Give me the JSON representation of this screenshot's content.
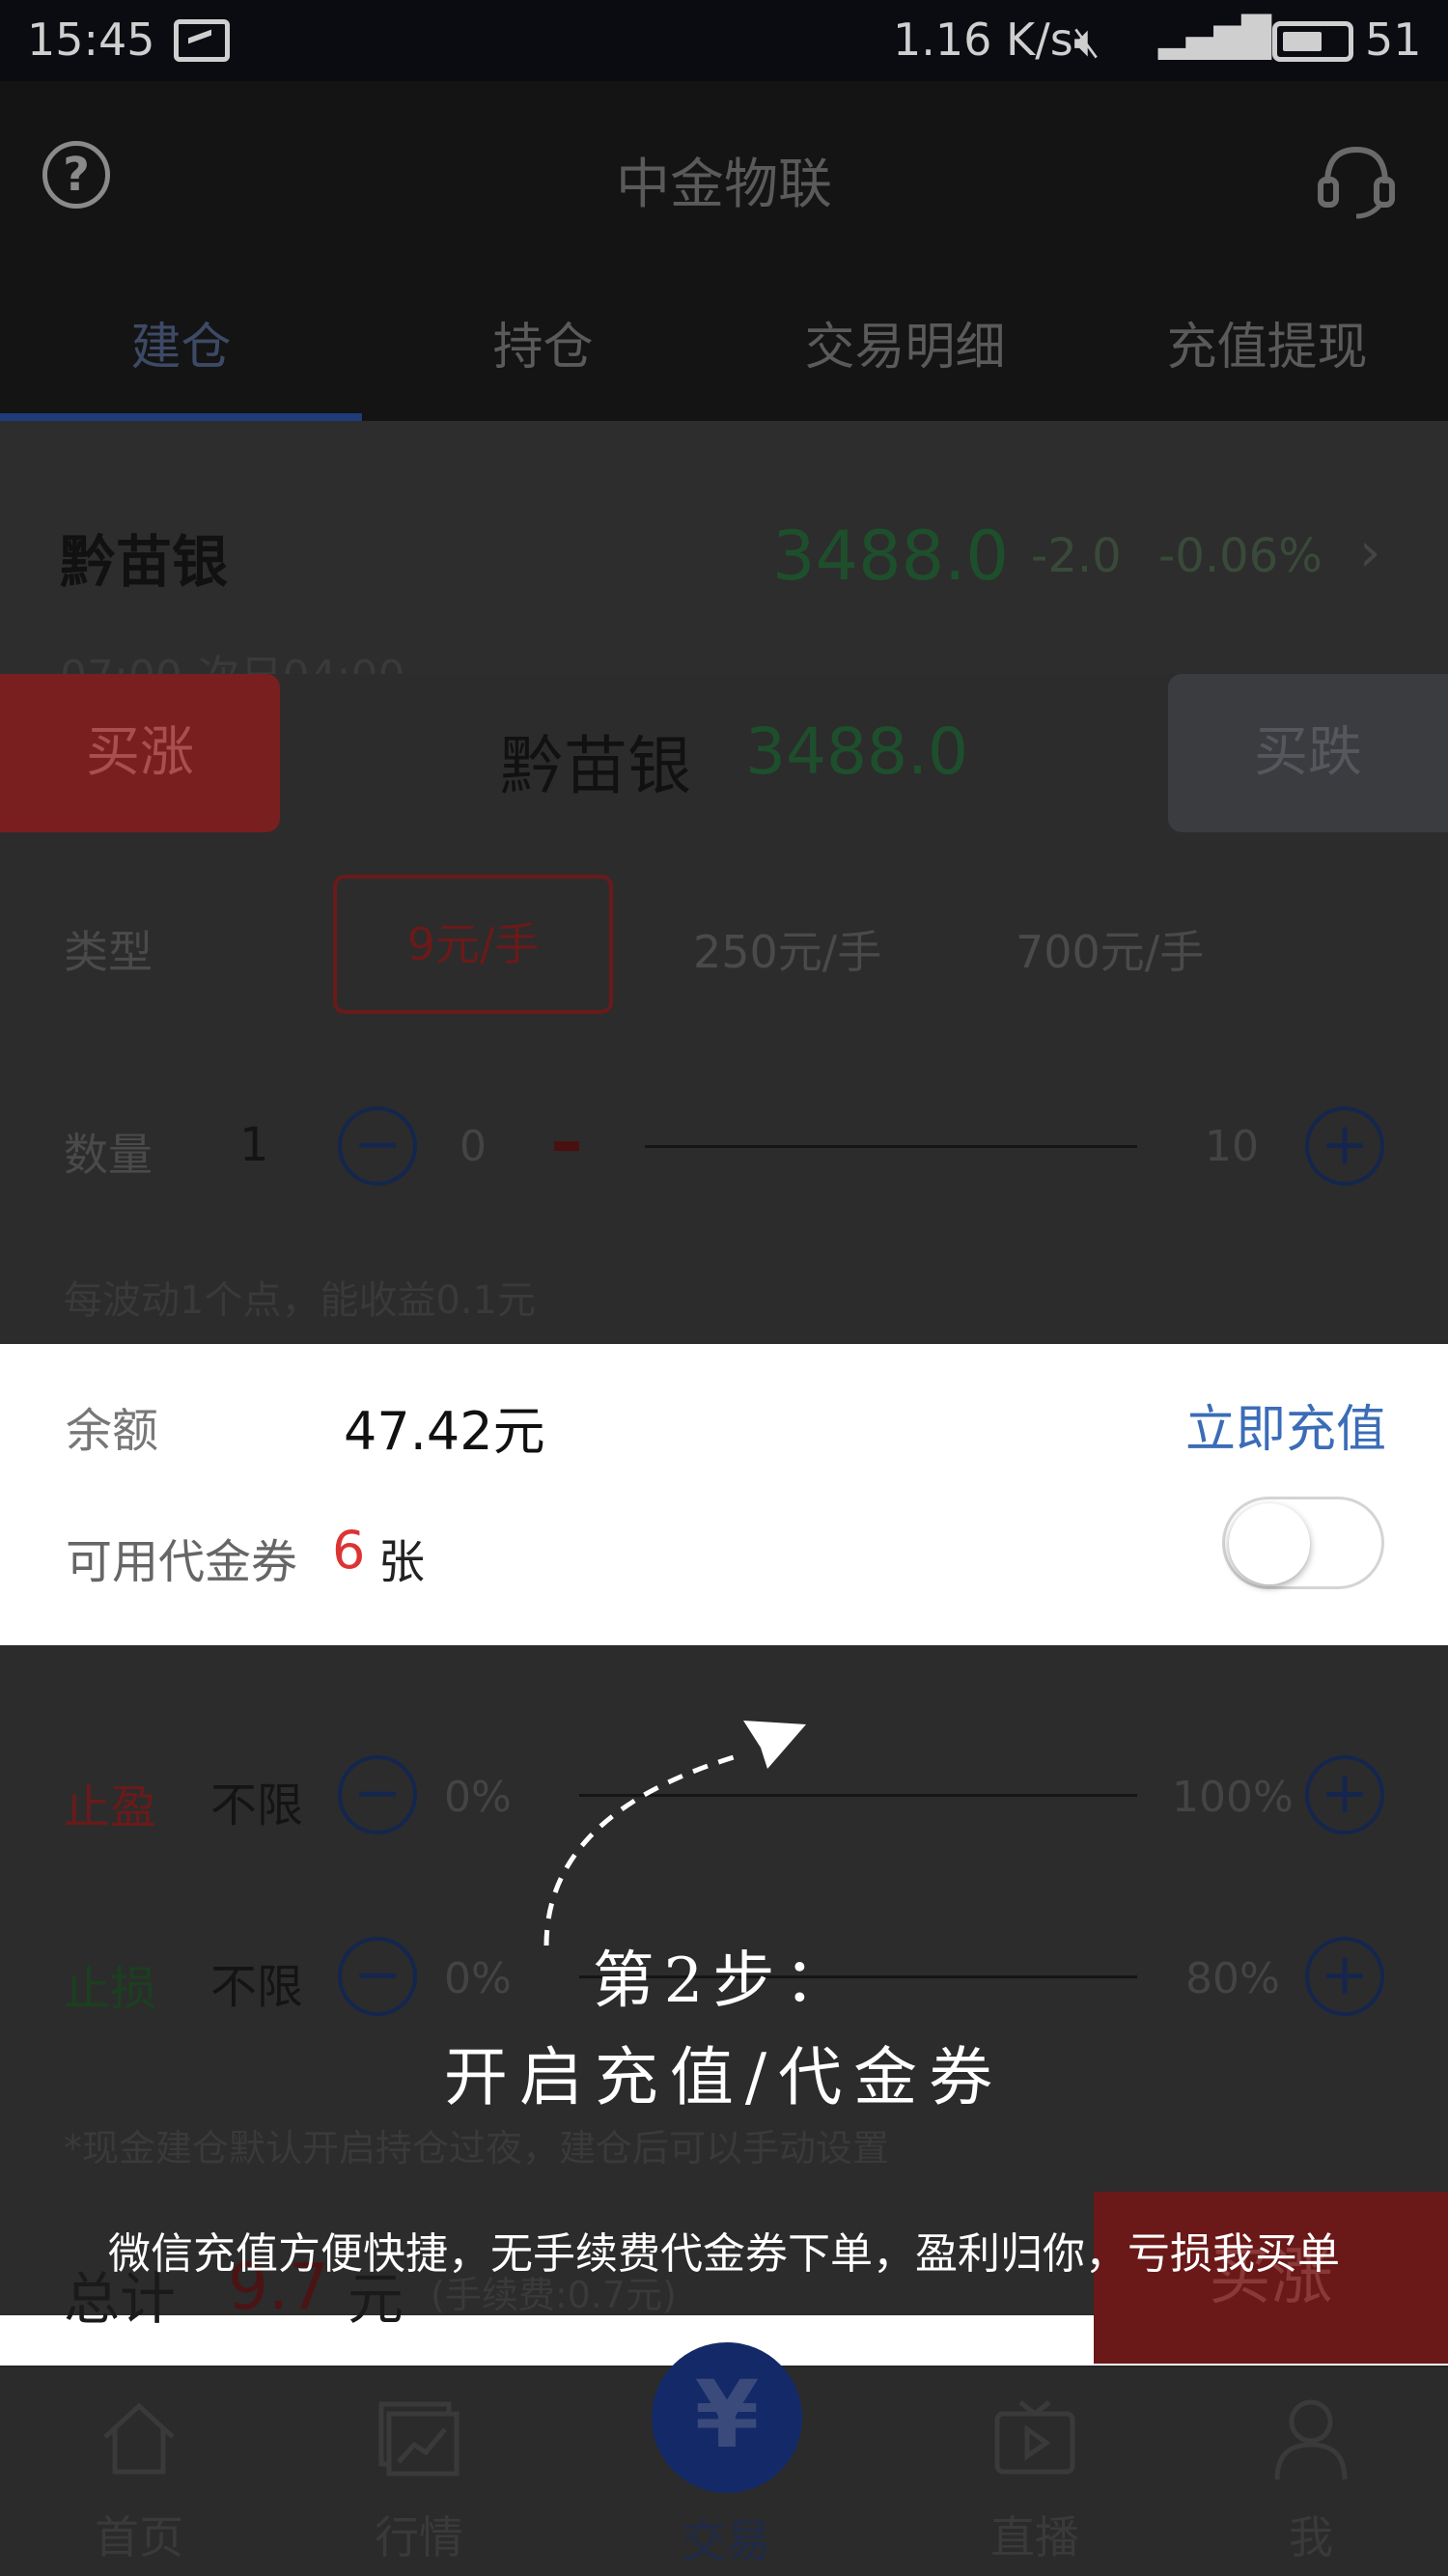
{
  "status_bar": {
    "time": "15:45",
    "speed": "1.16 K/s",
    "network": "4G",
    "battery": "51"
  },
  "header": {
    "title": "中金物联",
    "tabs": [
      "建仓",
      "持仓",
      "交易明细",
      "充值提现"
    ]
  },
  "instrument": {
    "name": "黔苗银",
    "price": "3488.0",
    "change": "-2.0",
    "change_pct": "-0.06%",
    "hours": "07:00-次日04:00"
  },
  "order": {
    "buy_up": "买涨",
    "buy_down": "买跌",
    "title": "黔苗银",
    "price": "3488.0",
    "type_label": "类型",
    "type_options": [
      "9元/手",
      "250元/手",
      "700元/手"
    ],
    "qty_label": "数量",
    "qty_value": "1",
    "qty_min": "0",
    "qty_max": "10",
    "point_note": "每波动1个点，能收益0.1元",
    "take_profit_label": "止盈",
    "take_profit_value": "不限",
    "tp_min": "0%",
    "tp_max": "100%",
    "stop_loss_label": "止损",
    "stop_loss_value": "不限",
    "sl_min": "0%",
    "sl_max": "80%",
    "overnight_note": "*现金建仓默认开启持仓过夜，建仓后可以手动设置",
    "total_label": "总计",
    "total_value": "9.7",
    "total_unit": "元",
    "fee_note": "(手续费:0.7元)",
    "buy_up_bottom": "买涨"
  },
  "account": {
    "balance_label": "余额",
    "balance_value": "47.42元",
    "recharge_link": "立即充值",
    "voucher_label": "可用代金券",
    "voucher_count": "6",
    "voucher_unit": "张",
    "voucher_toggle_on": false
  },
  "guide": {
    "step": "第2步：",
    "action": "开启充值/代金券",
    "description": "微信充值方便快捷，无手续费代金券下单，盈利归你，亏损我买单"
  },
  "bottom_nav": {
    "items": [
      "首页",
      "行情",
      "交易",
      "直播",
      "我"
    ],
    "trade_symbol": "¥"
  }
}
